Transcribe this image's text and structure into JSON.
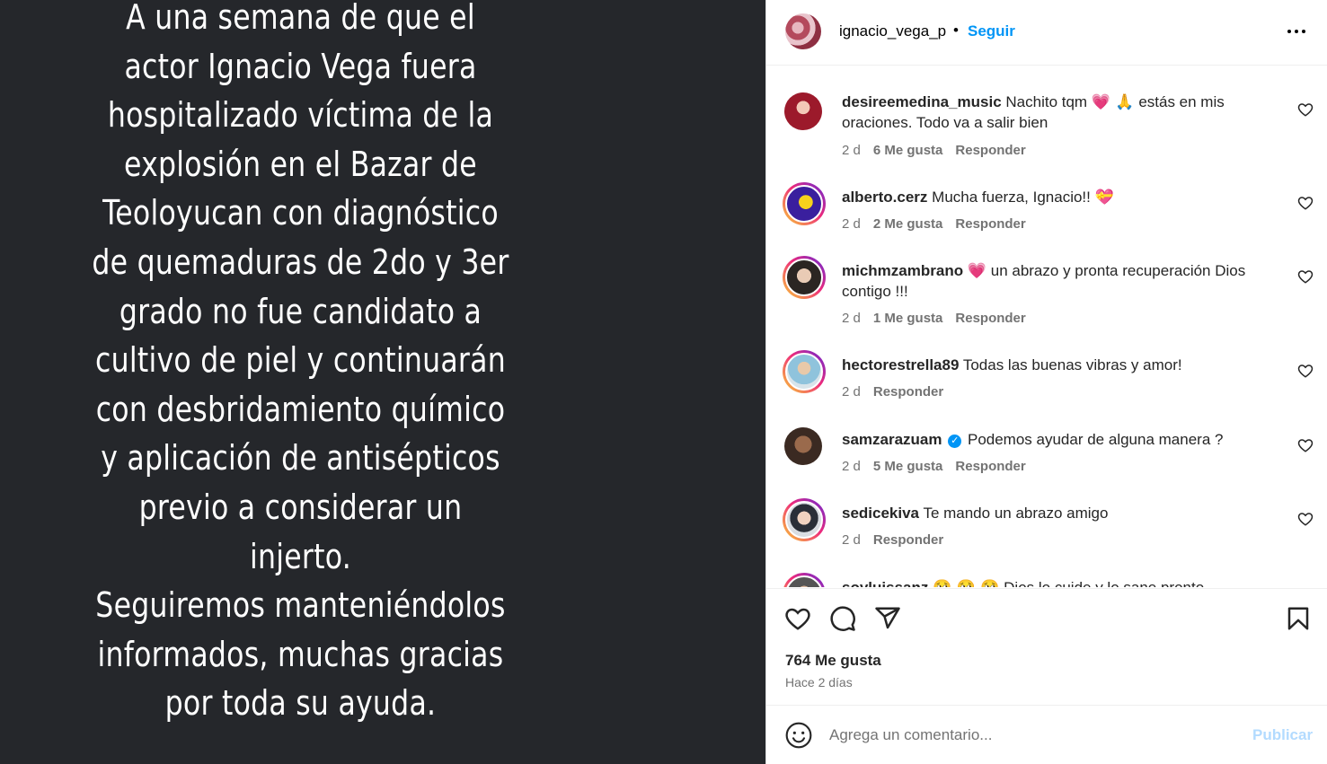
{
  "media": {
    "paragraph1_lines": [
      "A una semana de que el",
      "actor Ignacio Vega fuera",
      "hospitalizado víctima de la",
      "explosión en el Bazar de",
      "Teoloyucan con diagnóstico",
      "de quemaduras de 2do y 3er",
      "grado no fue candidato a",
      "cultivo de piel y continuarán",
      "con desbridamiento químico",
      "y aplicación de antisépticos",
      "previo a considerar un",
      "injerto."
    ],
    "paragraph2_lines": [
      "Seguiremos manteniéndolos",
      "informados, muchas gracias",
      "por toda su ayuda."
    ]
  },
  "header": {
    "username": "ignacio_vega_p",
    "dot": "•",
    "follow_label": "Seguir"
  },
  "comments": [
    {
      "user": "desireemedina_music",
      "text": "Nachito tqm",
      "emojis": "💗 🙏",
      "text2": "estás en mis oraciones. Todo va a salir bien",
      "time": "2 d",
      "likes": "6 Me gusta",
      "reply": "Responder"
    },
    {
      "user": "alberto.cerz",
      "text": "Mucha fuerza, Ignacio!!",
      "emojis": "💝",
      "time": "2 d",
      "likes": "2 Me gusta",
      "reply": "Responder"
    },
    {
      "user": "michmzambrano",
      "emojis": "💗",
      "text": "un abrazo y pronta recuperación Dios contigo !!!",
      "time": "2 d",
      "likes": "1 Me gusta",
      "reply": "Responder"
    },
    {
      "user": "hectorestrella89",
      "text": "Todas las buenas vibras y amor!",
      "time": "2 d",
      "reply": "Responder"
    },
    {
      "user": "samzarazuam",
      "verified": "✓",
      "text": "Podemos ayudar de alguna manera ?",
      "time": "2 d",
      "likes": "5 Me gusta",
      "reply": "Responder"
    },
    {
      "user": "sedicekiva",
      "text": "Te mando un abrazo amigo",
      "time": "2 d",
      "reply": "Responder"
    },
    {
      "user": "soyluissanz",
      "emojis": "🥺 🥺 🥺",
      "text": "Dios lo cuide y lo sane pronto"
    }
  ],
  "post": {
    "likes": "764 Me gusta",
    "ago": "Hace 2 días"
  },
  "composer": {
    "placeholder": "Agrega un comentario...",
    "publish_label": "Publicar"
  },
  "colors": {
    "media_bg": "#25272b",
    "link_blue": "#0095f6",
    "publish_disabled": "#b3dbff"
  }
}
